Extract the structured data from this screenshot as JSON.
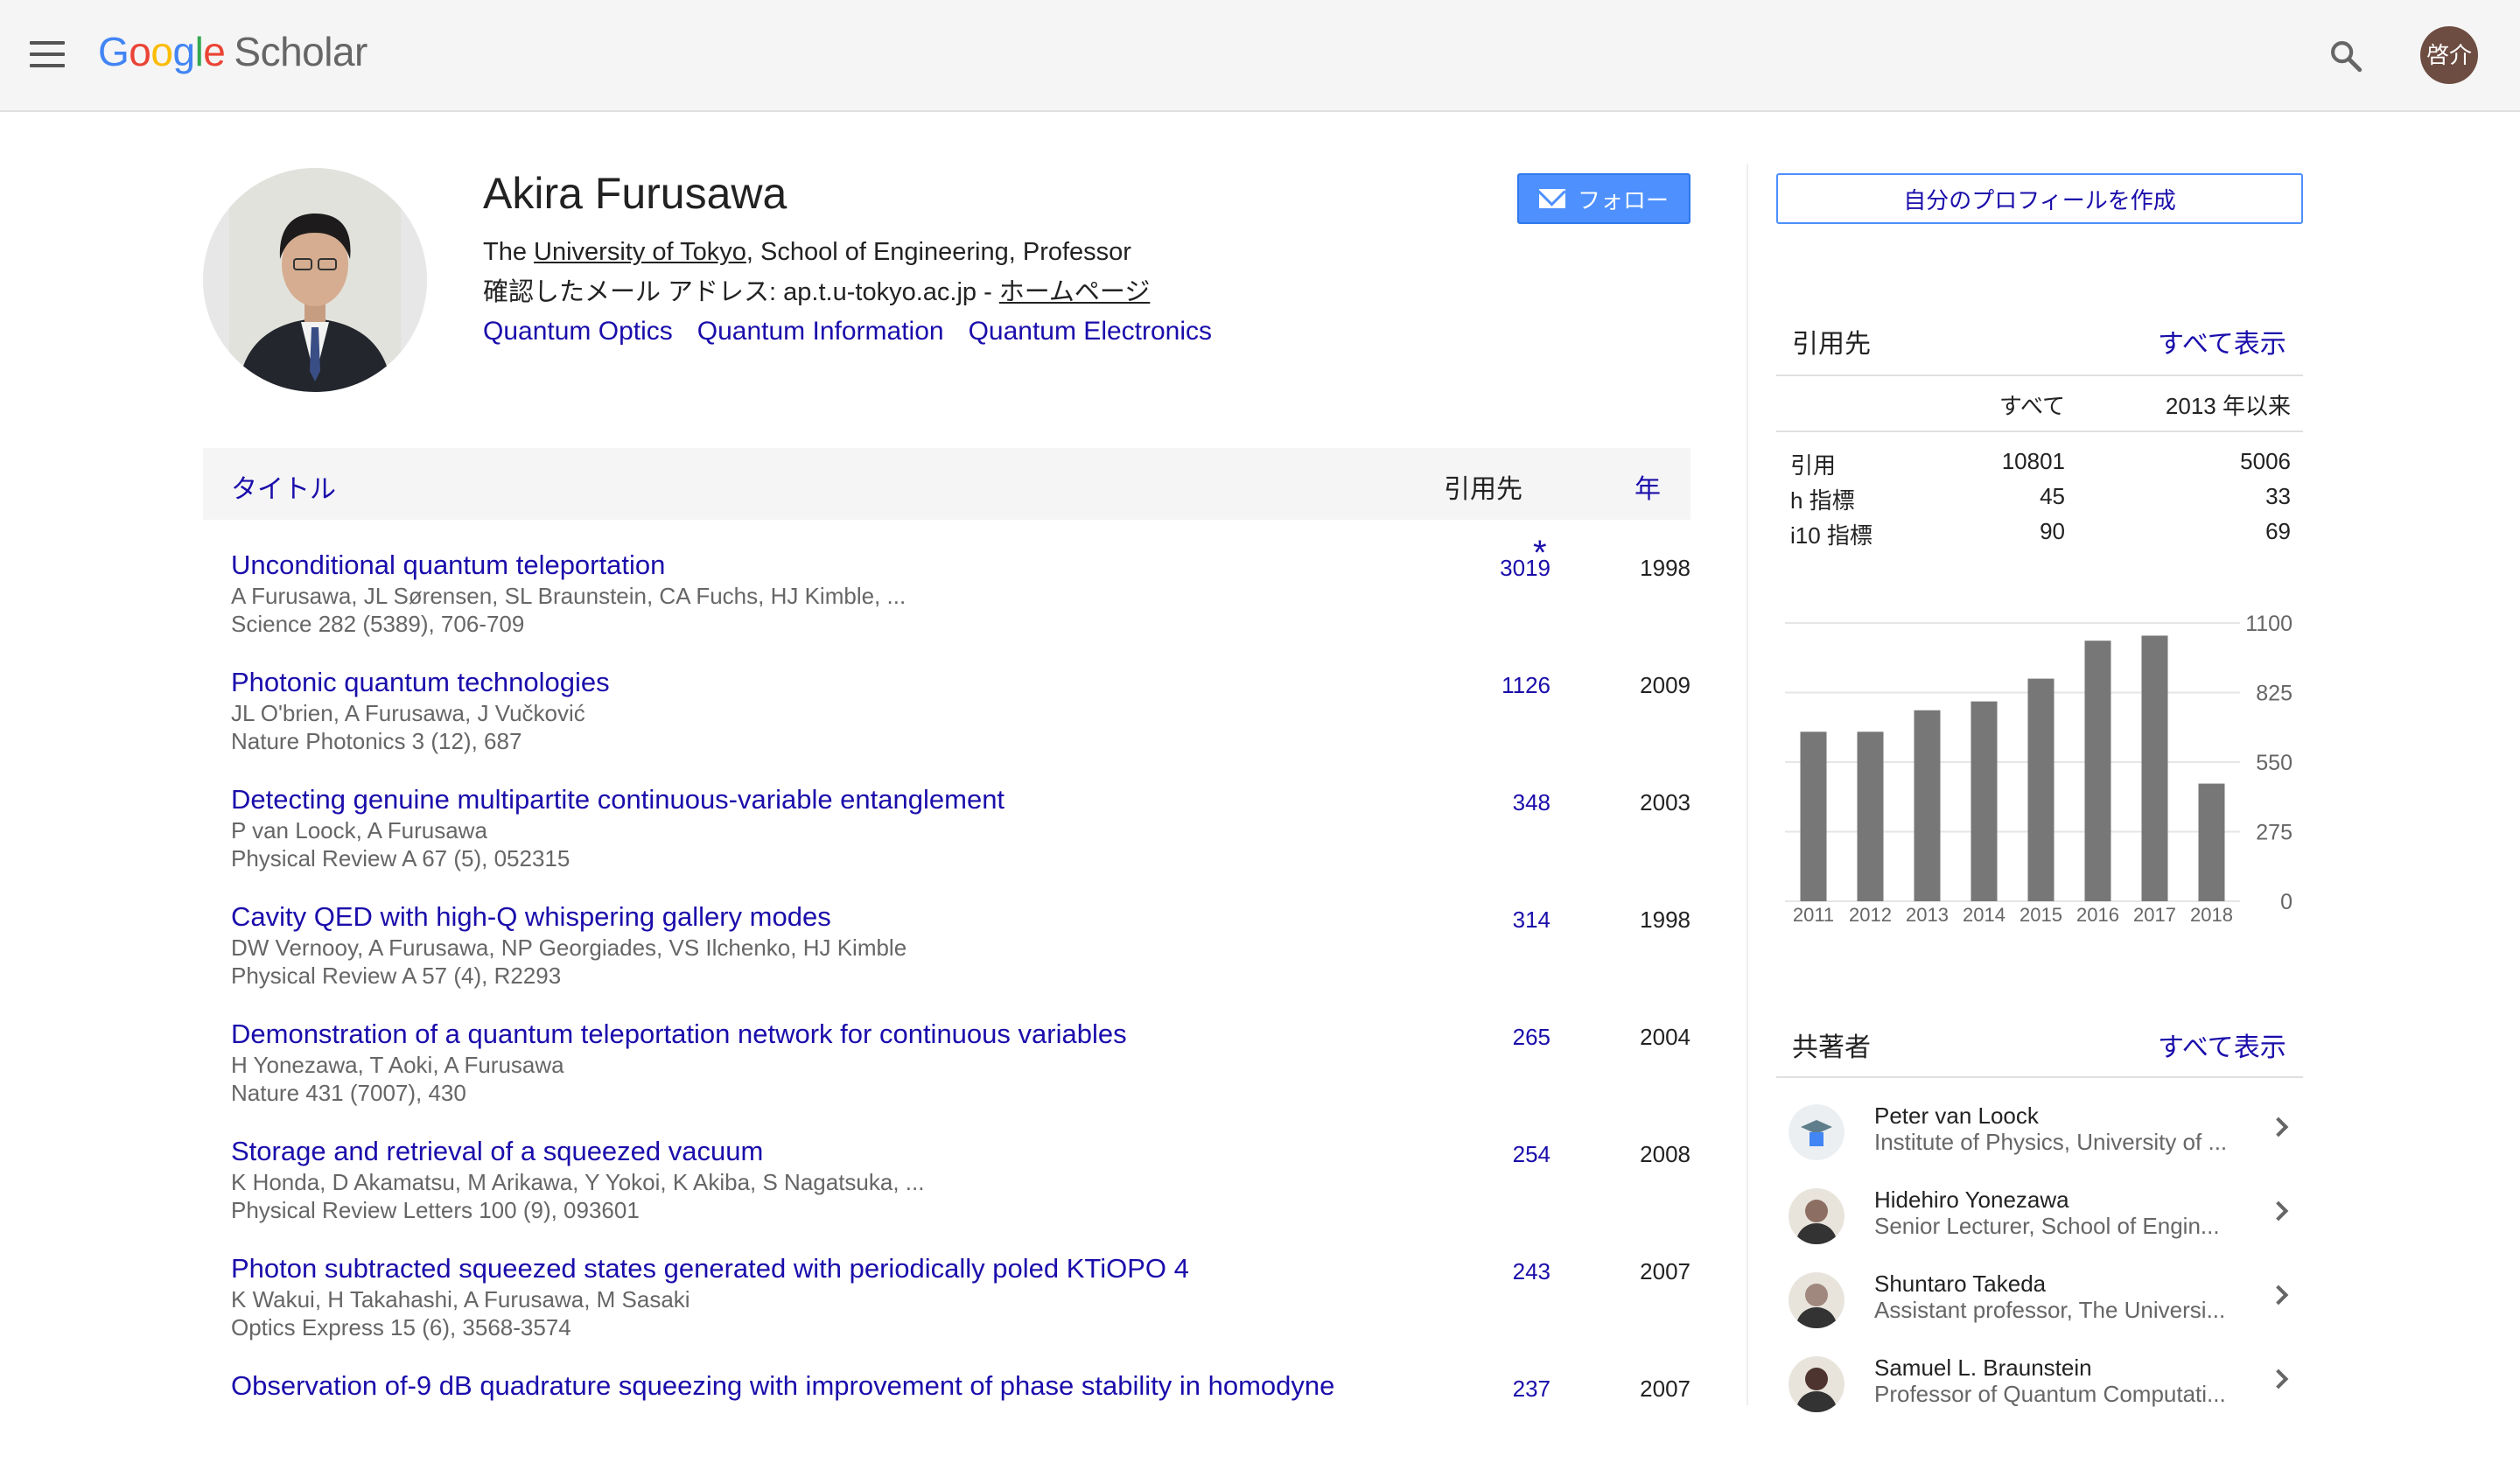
{
  "header": {
    "logo_google_letters": [
      "G",
      "o",
      "o",
      "g",
      "l",
      "e"
    ],
    "logo_scholar": "Scholar",
    "avatar_text": "啓介"
  },
  "profile": {
    "name": "Akira Furusawa",
    "affil_prefix": "The ",
    "affil_link": "University of Tokyo",
    "affil_suffix": ", School of Engineering, Professor",
    "email_text": "確認したメール アドレス: ap.t.u-tokyo.ac.jp - ",
    "homepage_link": "ホームページ",
    "interests": [
      "Quantum Optics",
      "Quantum Information",
      "Quantum Electronics"
    ],
    "follow_label": "フォロー"
  },
  "table": {
    "header_title": "タイトル",
    "header_cited": "引用先",
    "header_year": "年",
    "rows": [
      {
        "title": "Unconditional quantum teleportation",
        "authors": "A Furusawa, JL Sørensen, SL Braunstein, CA Fuchs, HJ Kimble, ...",
        "venue": "Science 282 (5389), 706-709",
        "cites": "3019",
        "star": "*",
        "year": "1998"
      },
      {
        "title": "Photonic quantum technologies",
        "authors": "JL O'brien, A Furusawa, J Vučković",
        "venue": "Nature Photonics 3 (12), 687",
        "cites": "1126",
        "star": "",
        "year": "2009"
      },
      {
        "title": "Detecting genuine multipartite continuous-variable entanglement",
        "authors": "P van Loock, A Furusawa",
        "venue": "Physical Review A 67 (5), 052315",
        "cites": "348",
        "star": "",
        "year": "2003"
      },
      {
        "title": "Cavity QED with high-Q whispering gallery modes",
        "authors": "DW Vernooy, A Furusawa, NP Georgiades, VS Ilchenko, HJ Kimble",
        "venue": "Physical Review A 57 (4), R2293",
        "cites": "314",
        "star": "",
        "year": "1998"
      },
      {
        "title": "Demonstration of a quantum teleportation network for continuous variables",
        "authors": "H Yonezawa, T Aoki, A Furusawa",
        "venue": "Nature 431 (7007), 430",
        "cites": "265",
        "star": "",
        "year": "2004"
      },
      {
        "title": "Storage and retrieval of a squeezed vacuum",
        "authors": "K Honda, D Akamatsu, M Arikawa, Y Yokoi, K Akiba, S Nagatsuka, ...",
        "venue": "Physical Review Letters 100 (9), 093601",
        "cites": "254",
        "star": "",
        "year": "2008"
      },
      {
        "title": "Photon subtracted squeezed states generated with periodically poled KTiOPO 4",
        "authors": "K Wakui, H Takahashi, A Furusawa, M Sasaki",
        "venue": "Optics Express 15 (6), 3568-3574",
        "cites": "243",
        "star": "",
        "year": "2007"
      },
      {
        "title": "Observation of-9 dB quadrature squeezing with improvement of phase stability in homodyne",
        "authors": "",
        "venue": "",
        "cites": "237",
        "star": "",
        "year": "2007"
      }
    ]
  },
  "sidebar": {
    "create_profile_label": "自分のプロフィールを作成",
    "cited_by_title": "引用先",
    "show_all": "すべて表示",
    "col_all": "すべて",
    "col_since": "2013 年以来",
    "metrics": [
      {
        "label": "引用",
        "all": "10801",
        "since": "5006"
      },
      {
        "label": "h 指標",
        "all": "45",
        "since": "33"
      },
      {
        "label": "i10 指標",
        "all": "90",
        "since": "69"
      }
    ],
    "coauthors_title": "共著者",
    "coauthors": [
      {
        "name": "Peter van Loock",
        "affiliation": "Institute of Physics, University of ..."
      },
      {
        "name": "Hidehiro Yonezawa",
        "affiliation": "Senior Lecturer, School of Engin..."
      },
      {
        "name": "Shuntaro Takeda",
        "affiliation": "Assistant professor, The Universi..."
      },
      {
        "name": "Samuel L. Braunstein",
        "affiliation": "Professor of Quantum Computati..."
      }
    ]
  },
  "chart_data": {
    "type": "bar",
    "categories": [
      "2011",
      "2012",
      "2013",
      "2014",
      "2015",
      "2016",
      "2017",
      "2018"
    ],
    "values": [
      670,
      670,
      755,
      790,
      880,
      1030,
      1050,
      465
    ],
    "ylim": [
      0,
      1100
    ],
    "yticks": [
      "1100",
      "825",
      "550",
      "275",
      "0"
    ],
    "bar_color": "#777777"
  }
}
